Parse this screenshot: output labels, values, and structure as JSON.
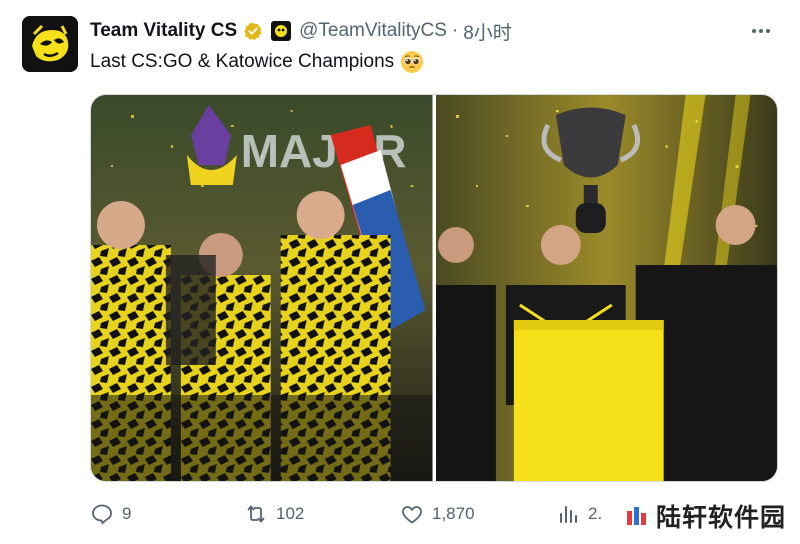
{
  "tweet": {
    "author_name": "Team Vitality CS",
    "handle": "@TeamVitalityCS",
    "separator": "·",
    "time": "8小时",
    "text": "Last CS:GO & Katowice Champions",
    "emoji": "pleading-face-emoji"
  },
  "media": {
    "images": [
      {
        "description": "team-celebration-with-trophy-and-flag",
        "banner": "MAJOR"
      },
      {
        "description": "team-lifting-trophy-on-stage"
      }
    ]
  },
  "actions": {
    "reply_count": "9",
    "retweet_count": "102",
    "like_count": "1,870",
    "views_count": "2."
  },
  "watermark": {
    "text": "陆轩软件园"
  },
  "colors": {
    "text_primary": "#0f1419",
    "text_secondary": "#536471",
    "verified_gold": "#e2b719",
    "vitality_yellow": "#f5e01a"
  }
}
